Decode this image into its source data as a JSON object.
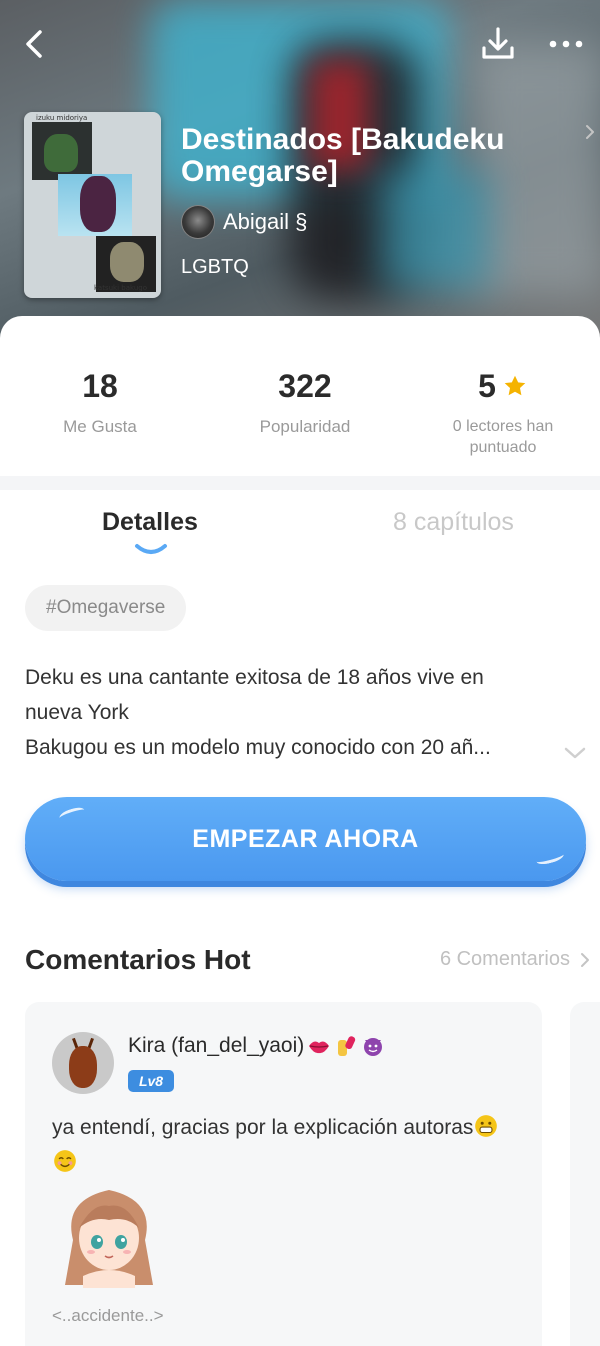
{
  "story": {
    "title": "Destinados [Bakudeku Omegarse]",
    "author": "Abigail §",
    "genre": "LGBTQ",
    "cover_captions": [
      "izuku midoriya",
      "katsuki bakugo"
    ]
  },
  "stats": {
    "likes": {
      "value": "18",
      "label": "Me Gusta"
    },
    "popularity": {
      "value": "322",
      "label": "Popularidad"
    },
    "rating": {
      "value": "5",
      "label": "0 lectores han puntuado"
    }
  },
  "tabs": {
    "details": "Detalles",
    "chapters": "8 capítulos",
    "active": "details"
  },
  "tag": "#Omegaverse",
  "synopsis": {
    "line1": "Deku es una cantante exitosa de 18 años vive en",
    "line2": "nueva York",
    "line3": "Bakugou es un modelo muy conocido con 20 añ..."
  },
  "start_button": "EMPEZAR AHORA",
  "comments_section": {
    "title": "Comentarios Hot",
    "count_link": "6 Comentarios",
    "comments": [
      {
        "user": "Kira (fan_del_yaoi)",
        "level": "Lv8",
        "text": "ya entendí, gracias por la explicación autoras",
        "signature": "<..accidente..>"
      }
    ]
  },
  "colors": {
    "accent_blue": "#4a98ef",
    "star": "#f5b301",
    "tab_indicator": "#5aa9f5",
    "level_badge": "#3d8de0"
  },
  "icons": [
    "back-arrow-icon",
    "download-icon",
    "more-dots-icon",
    "star-icon",
    "chevron-right-icon",
    "chevron-down-icon"
  ]
}
